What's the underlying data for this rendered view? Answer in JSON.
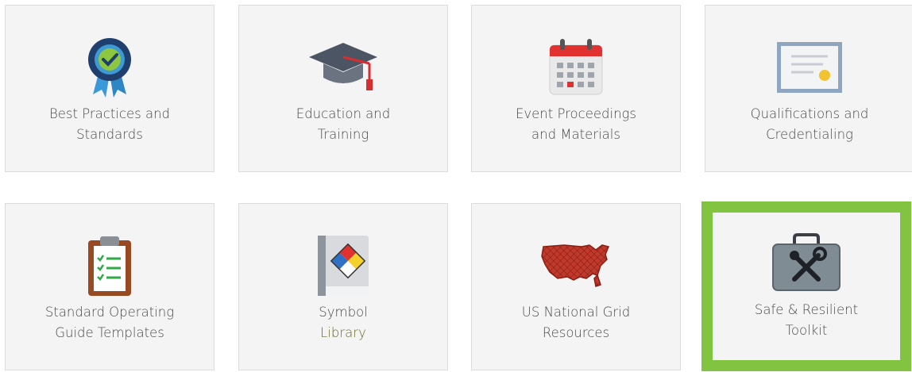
{
  "tiles": [
    {
      "id": "best-practices",
      "line1": "Best Practices and",
      "line2": "Standards",
      "icon": "award-ribbon-icon"
    },
    {
      "id": "education",
      "line1": "Education and",
      "line2": "Training",
      "icon": "graduation-cap-icon"
    },
    {
      "id": "events",
      "line1": "Event Proceedings",
      "line2": "and Materials",
      "icon": "calendar-icon"
    },
    {
      "id": "qualifications",
      "line1": "Qualifications and",
      "line2": "Credentialing",
      "icon": "certificate-icon"
    },
    {
      "id": "sog-templates",
      "line1": "Standard Operating",
      "line2": "Guide Templates",
      "icon": "clipboard-checklist-icon"
    },
    {
      "id": "symbol-library",
      "line1": "Symbol",
      "line2": "Library",
      "icon": "symbol-book-icon"
    },
    {
      "id": "us-grid",
      "line1": "US National Grid",
      "line2": "Resources",
      "icon": "us-map-grid-icon"
    },
    {
      "id": "toolkit",
      "line1": "Safe & Resilient",
      "line2": "Toolkit",
      "icon": "toolbox-icon",
      "highlighted": true
    }
  ],
  "colors": {
    "highlight_border": "#82c341",
    "tile_background": "#f4f4f4",
    "label_text": "#4a4a4a"
  }
}
